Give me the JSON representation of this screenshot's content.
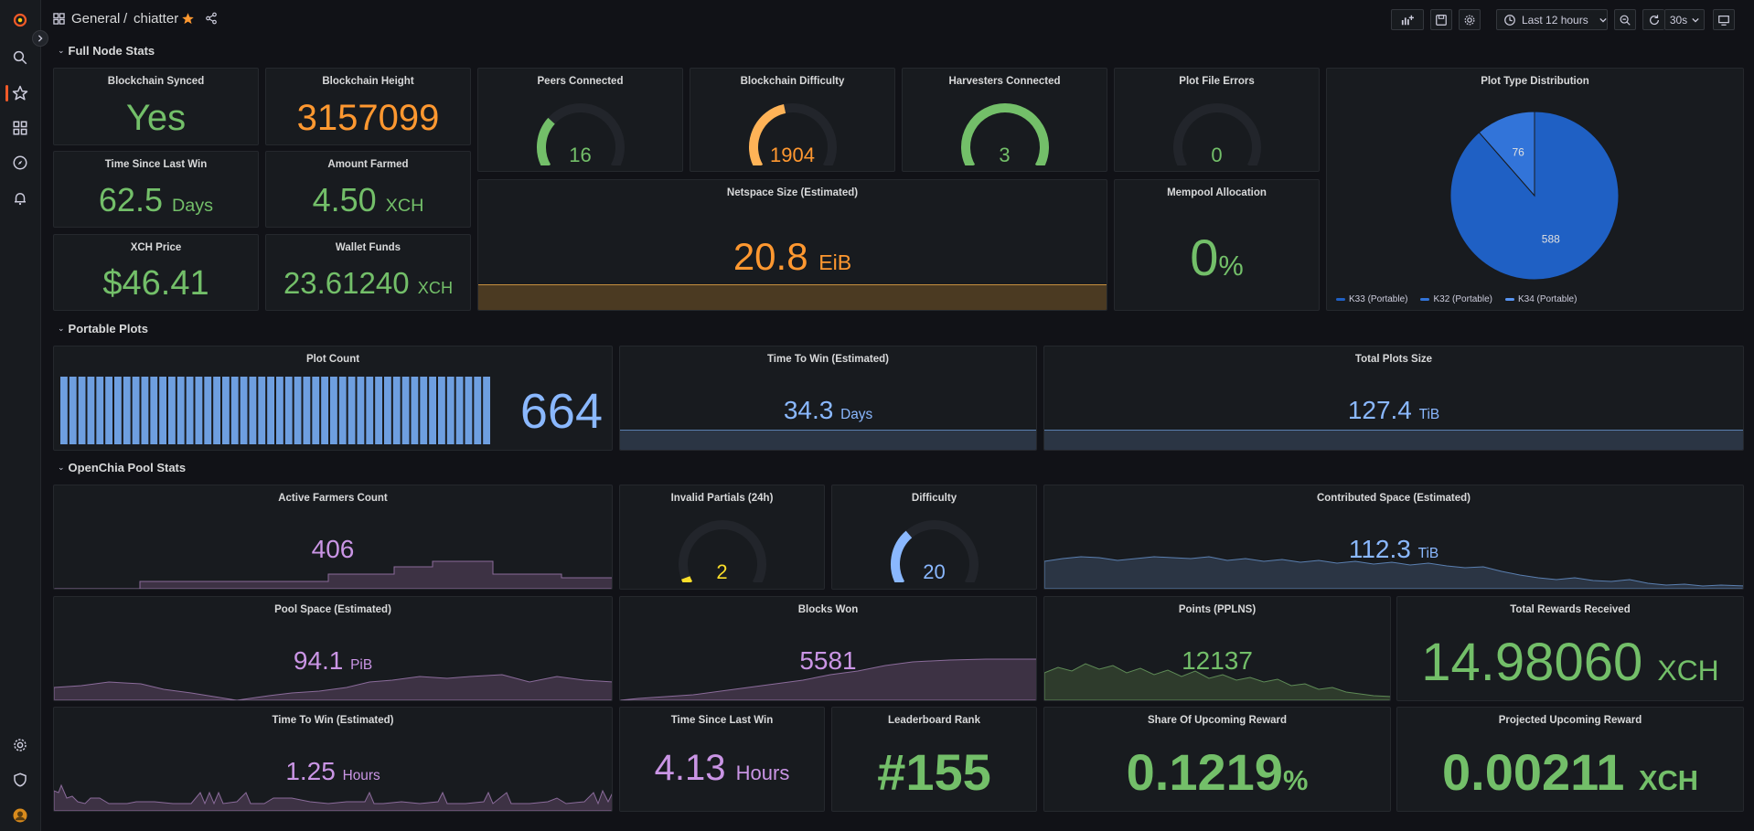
{
  "breadcrumb": {
    "folder": "General",
    "separator": "/",
    "dashboard": "chiatter"
  },
  "toolbar": {
    "time_range": "Last 12 hours",
    "refresh_interval": "30s"
  },
  "rows": {
    "full_node": "Full Node Stats",
    "portable": "Portable Plots",
    "pool": "OpenChia Pool Stats"
  },
  "full_node": {
    "synced": {
      "title": "Blockchain Synced",
      "value": "Yes"
    },
    "height": {
      "title": "Blockchain Height",
      "value": "3157099"
    },
    "peers": {
      "title": "Peers Connected",
      "value": "16",
      "fraction": 0.3
    },
    "difficulty": {
      "title": "Blockchain Difficulty",
      "value": "1904",
      "fraction": 0.45
    },
    "harvesters": {
      "title": "Harvesters Connected",
      "value": "3",
      "fraction": 1.0
    },
    "plot_errors": {
      "title": "Plot File Errors",
      "value": "0",
      "fraction": 0
    },
    "plot_type": {
      "title": "Plot Type Distribution",
      "legend": [
        "K33 (Portable)",
        "K32 (Portable)",
        "K34 (Portable)"
      ],
      "values": [
        588,
        76
      ],
      "labels": [
        "588",
        "76"
      ]
    },
    "last_win": {
      "title": "Time Since Last Win",
      "value": "62.5",
      "unit": "Days"
    },
    "farmed": {
      "title": "Amount Farmed",
      "value": "4.50",
      "unit": "XCH"
    },
    "netspace": {
      "title": "Netspace Size (Estimated)",
      "value": "20.8",
      "unit": "EiB"
    },
    "mempool": {
      "title": "Mempool Allocation",
      "value": "0",
      "unit": "%"
    },
    "price": {
      "title": "XCH Price",
      "value": "$46.41"
    },
    "wallet": {
      "title": "Wallet Funds",
      "value": "23.61240",
      "unit": "XCH"
    }
  },
  "portable": {
    "plot_count": {
      "title": "Plot Count",
      "value": "664"
    },
    "ttw": {
      "title": "Time To Win (Estimated)",
      "value": "34.3",
      "unit": "Days"
    },
    "total_size": {
      "title": "Total Plots Size",
      "value": "127.4",
      "unit": "TiB"
    }
  },
  "pool": {
    "farmers": {
      "title": "Active Farmers Count",
      "value": "406"
    },
    "invalid": {
      "title": "Invalid Partials (24h)",
      "value": "2",
      "fraction": 0.04
    },
    "difficulty": {
      "title": "Difficulty",
      "value": "20",
      "fraction": 0.33
    },
    "contributed": {
      "title": "Contributed Space (Estimated)",
      "value": "112.3",
      "unit": "TiB"
    },
    "pool_space": {
      "title": "Pool Space (Estimated)",
      "value": "94.1",
      "unit": "PiB"
    },
    "blocks_won": {
      "title": "Blocks Won",
      "value": "5581"
    },
    "points": {
      "title": "Points (PPLNS)",
      "value": "12137"
    },
    "rewards": {
      "title": "Total Rewards Received",
      "value": "14.98060",
      "unit": "XCH"
    },
    "ttw": {
      "title": "Time To Win (Estimated)",
      "value": "1.25",
      "unit": "Hours"
    },
    "last_win": {
      "title": "Time Since Last Win",
      "value": "4.13",
      "unit": "Hours"
    },
    "rank": {
      "title": "Leaderboard Rank",
      "value": "#155"
    },
    "share": {
      "title": "Share Of Upcoming Reward",
      "value": "0.1219",
      "unit": "%"
    },
    "projected": {
      "title": "Projected Upcoming Reward",
      "value": "0.00211",
      "unit": "XCH"
    }
  },
  "colors": {
    "green": "#73bf69",
    "orange": "#ff9830",
    "blue": "#8ab8ff",
    "purple": "#ca95e5",
    "yellow": "#fade2a",
    "accent": "#f05a28"
  }
}
